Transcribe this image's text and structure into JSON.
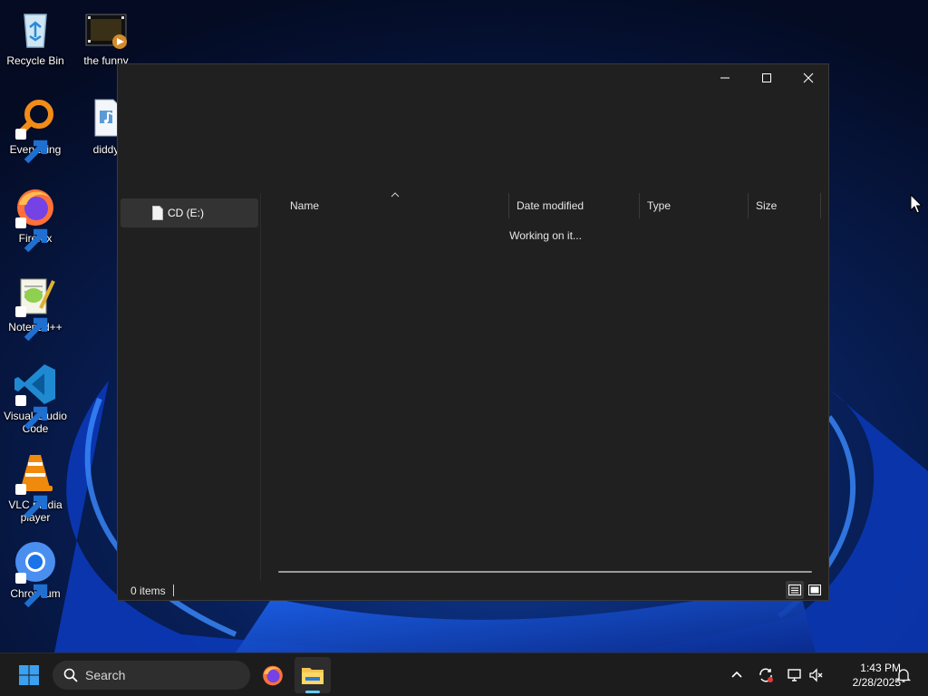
{
  "desktop": {
    "icons": [
      {
        "label": "Recycle Bin",
        "icon": "recycle-bin-icon"
      },
      {
        "label": "the funny",
        "icon": "video-file-icon"
      },
      {
        "label": "Everything",
        "icon": "everything-search-icon"
      },
      {
        "label": "diddy",
        "icon": "audio-file-icon"
      },
      {
        "label": "Firefox",
        "icon": "firefox-icon"
      },
      {
        "label": "Notepad++",
        "icon": "notepad-plus-plus-icon"
      },
      {
        "label": "Visual Studio Code",
        "icon": "vscode-icon"
      },
      {
        "label": "VLC media player",
        "icon": "vlc-icon"
      },
      {
        "label": "Chromium",
        "icon": "chromium-icon"
      }
    ]
  },
  "explorer": {
    "nav": {
      "drive_label": "CD (E:)"
    },
    "columns": {
      "name": "Name",
      "date_modified": "Date modified",
      "type": "Type",
      "size": "Size"
    },
    "loading_text": "Working on it...",
    "status": {
      "item_count": "0 items"
    }
  },
  "taskbar": {
    "search_label": "Search",
    "clock": {
      "time": "1:43 PM",
      "date": "2/28/2025"
    }
  },
  "colors": {
    "window_bg": "#202020",
    "selection_bg": "#333333",
    "taskbar_bg": "#1c1c1c",
    "accent": "#60cdff"
  }
}
